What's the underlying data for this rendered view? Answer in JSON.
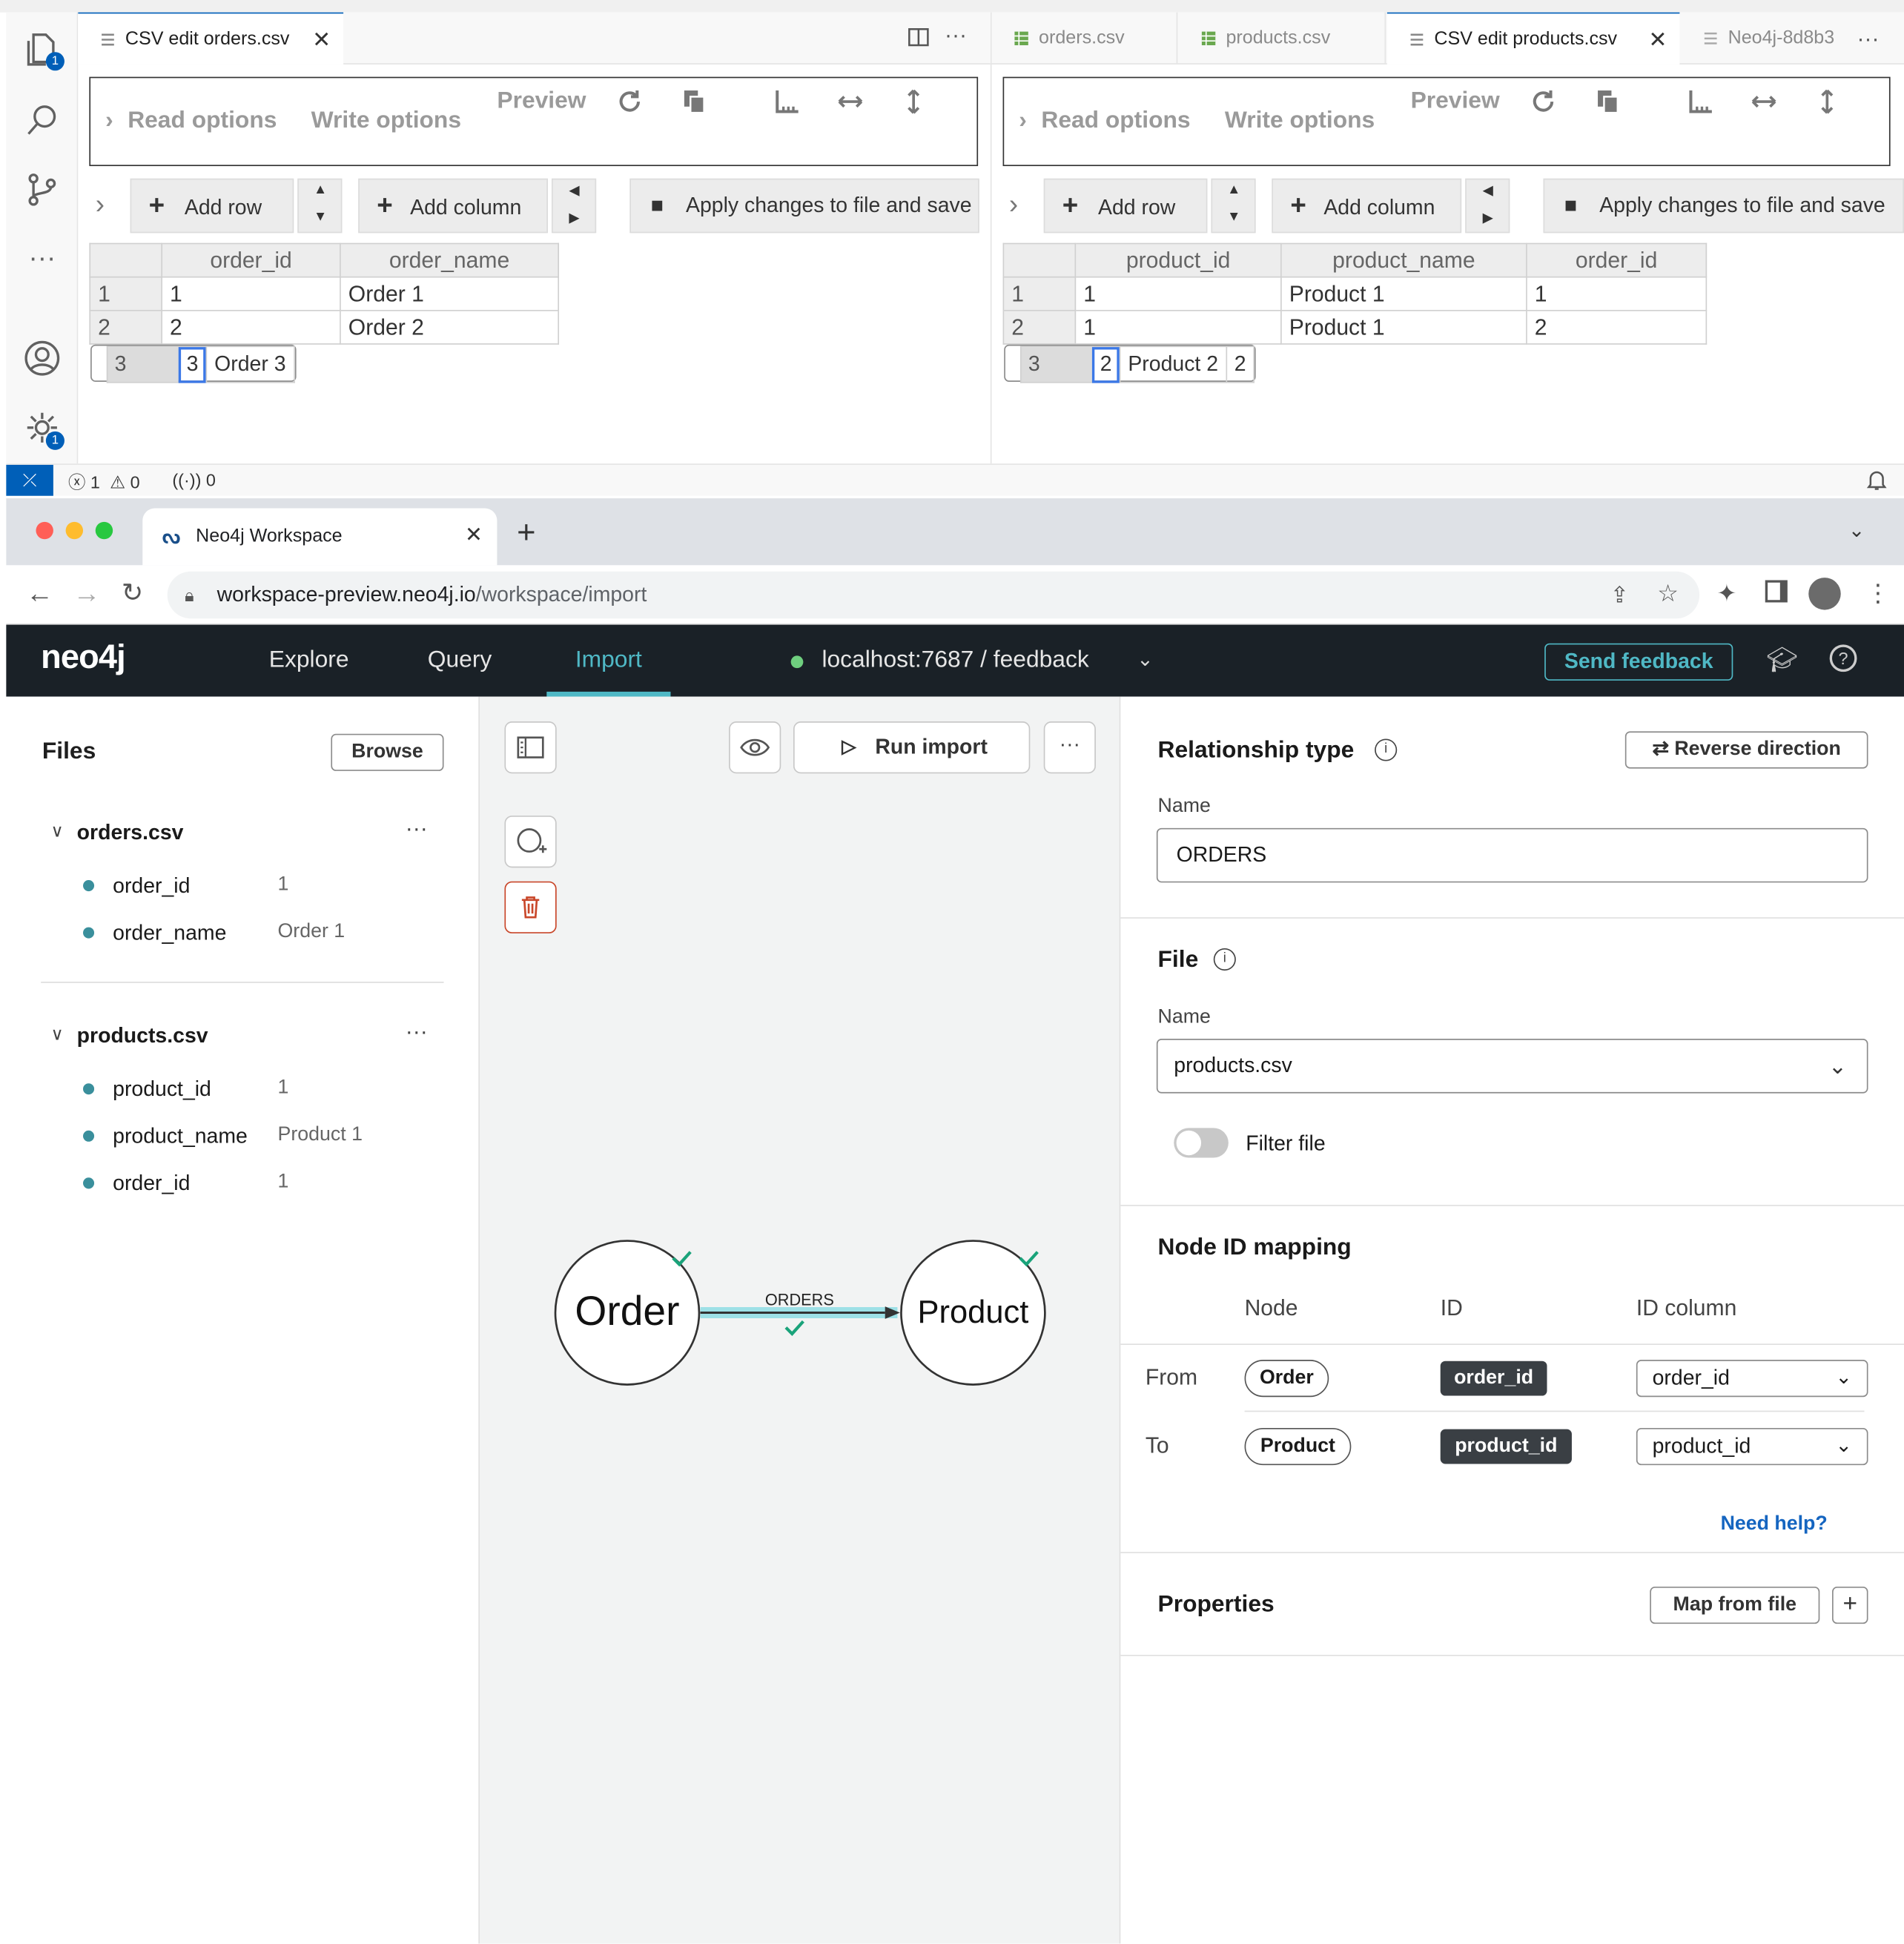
{
  "vscode": {
    "activity_badge_files": "1",
    "activity_badge_settings": "1",
    "left_editor": {
      "tabs": [
        {
          "label": "CSV edit orders.csv"
        }
      ],
      "read_options": "Read options",
      "write_options": "Write options",
      "preview": "Preview",
      "add_row": "Add row",
      "add_column": "Add column",
      "apply": "Apply changes to file and save",
      "columns": [
        "order_id",
        "order_name"
      ],
      "rows": [
        [
          "1",
          "1",
          "Order 1"
        ],
        [
          "2",
          "2",
          "Order 2"
        ],
        [
          "3",
          "3",
          "Order 3"
        ]
      ]
    },
    "right_editor": {
      "tabs": [
        {
          "label": "orders.csv"
        },
        {
          "label": "products.csv"
        },
        {
          "label": "CSV edit products.csv"
        },
        {
          "label": "Neo4j-8d8b3"
        }
      ],
      "read_options": "Read options",
      "write_options": "Write options",
      "preview": "Preview",
      "add_row": "Add row",
      "add_column": "Add column",
      "apply": "Apply changes to file and save",
      "columns": [
        "product_id",
        "product_name",
        "order_id"
      ],
      "rows": [
        [
          "1",
          "1",
          "Product 1",
          "1"
        ],
        [
          "2",
          "1",
          "Product 1",
          "2"
        ],
        [
          "3",
          "2",
          "Product 2",
          "2"
        ]
      ]
    },
    "status": {
      "errors": "1",
      "warnings": "0",
      "ports": "0"
    }
  },
  "browser": {
    "tab_title": "Neo4j Workspace",
    "url_host": "workspace-preview.neo4j.io",
    "url_path": "/workspace/import"
  },
  "neo4j": {
    "logo": "neo4j",
    "nav": [
      "Explore",
      "Query",
      "Import"
    ],
    "active_nav": "Import",
    "connection": "localhost:7687 / feedback",
    "send_feedback": "Send feedback",
    "files_title": "Files",
    "browse": "Browse",
    "files": [
      {
        "name": "orders.csv",
        "props": [
          {
            "key": "order_id",
            "value": "1"
          },
          {
            "key": "order_name",
            "value": "Order 1"
          }
        ]
      },
      {
        "name": "products.csv",
        "props": [
          {
            "key": "product_id",
            "value": "1"
          },
          {
            "key": "product_name",
            "value": "Product 1"
          },
          {
            "key": "order_id",
            "value": "1"
          }
        ]
      }
    ],
    "run_import": "Run import",
    "graph": {
      "from_node": "Order",
      "to_node": "Product",
      "relationship": "ORDERS"
    },
    "details": {
      "relationship_type": "Relationship type",
      "reverse_direction": "Reverse direction",
      "name_label": "Name",
      "name_value": "ORDERS",
      "file_title": "File",
      "file_name_label": "Name",
      "file_value": "products.csv",
      "filter_file": "Filter file",
      "node_id_mapping": "Node ID mapping",
      "col_node": "Node",
      "col_id": "ID",
      "col_id_column": "ID column",
      "from_label": "From",
      "from_node": "Order",
      "from_id": "order_id",
      "from_column": "order_id",
      "to_label": "To",
      "to_node": "Product",
      "to_id": "product_id",
      "to_column": "product_id",
      "need_help": "Need help?",
      "properties": "Properties",
      "map_from_file": "Map from file"
    }
  },
  "colors": {
    "accent": "#4fb8c5",
    "nav_bg": "#1a2127",
    "vscode_blue": "#005fb8",
    "check": "#1aa37a"
  }
}
